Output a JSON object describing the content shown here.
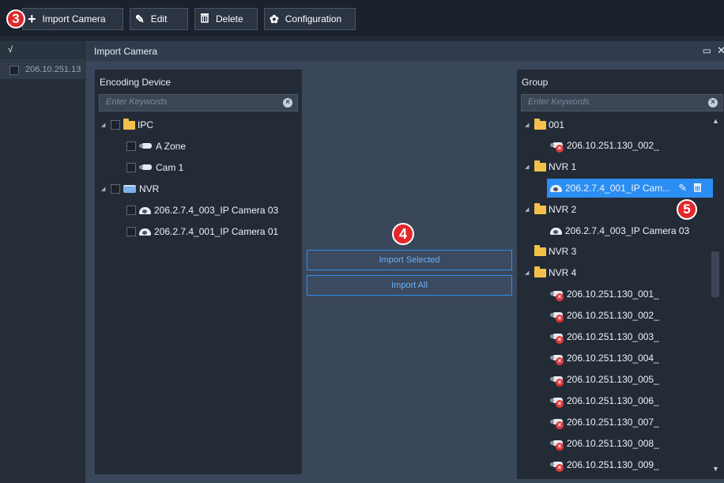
{
  "toolbar": {
    "buttons": [
      {
        "label": "Import Camera",
        "icon": "plus-icon"
      },
      {
        "label": "Edit",
        "icon": "pencil-icon"
      },
      {
        "label": "Delete",
        "icon": "trash-icon"
      },
      {
        "label": "Configuration",
        "icon": "gear-icon"
      }
    ]
  },
  "markers": [
    "3",
    "4",
    "5"
  ],
  "left_list": {
    "header_check": "√",
    "rows": [
      "206.10.251.13"
    ]
  },
  "dialog": {
    "title": "Import Camera",
    "encoding_panel": {
      "title": "Encoding Device",
      "search_placeholder": "Enter Keywords",
      "tree": [
        {
          "label": "IPC",
          "type": "folder"
        },
        {
          "label": "A Zone",
          "type": "camera"
        },
        {
          "label": "Cam 1",
          "type": "camera"
        },
        {
          "label": "NVR",
          "type": "nvr"
        },
        {
          "label": "206.2.7.4_003_IP Camera 03",
          "type": "dome"
        },
        {
          "label": "206.2.7.4_001_IP Camera 01",
          "type": "dome"
        }
      ]
    },
    "middle": {
      "import_selected": "Import Selected",
      "import_all": "Import All"
    },
    "group_panel": {
      "title": "Group",
      "search_placeholder": "Enter Keywords",
      "tree": [
        {
          "label": "001",
          "type": "folder"
        },
        {
          "label": "206.10.251.130_002_",
          "type": "camera-offline"
        },
        {
          "label": "NVR 1",
          "type": "folder"
        },
        {
          "label": "206.2.7.4_001_IP Cam...",
          "type": "dome",
          "selected": true
        },
        {
          "label": "NVR 2",
          "type": "folder"
        },
        {
          "label": "206.2.7.4_003_IP Camera 03",
          "type": "dome"
        },
        {
          "label": "NVR 3",
          "type": "folder"
        },
        {
          "label": "NVR 4",
          "type": "folder"
        },
        {
          "label": "206.10.251.130_001_",
          "type": "camera-offline"
        },
        {
          "label": "206.10.251.130_002_",
          "type": "camera-offline"
        },
        {
          "label": "206.10.251.130_003_",
          "type": "camera-offline"
        },
        {
          "label": "206.10.251.130_004_",
          "type": "camera-offline"
        },
        {
          "label": "206.10.251.130_005_",
          "type": "camera-offline"
        },
        {
          "label": "206.10.251.130_006_",
          "type": "camera-offline"
        },
        {
          "label": "206.10.251.130_007_",
          "type": "camera-offline"
        },
        {
          "label": "206.10.251.130_008_",
          "type": "camera-offline"
        },
        {
          "label": "206.10.251.130_009_",
          "type": "camera-offline"
        }
      ]
    }
  },
  "colors": {
    "accent": "#2c8ef2",
    "marker": "#e0282d",
    "folder": "#f3c14a"
  }
}
